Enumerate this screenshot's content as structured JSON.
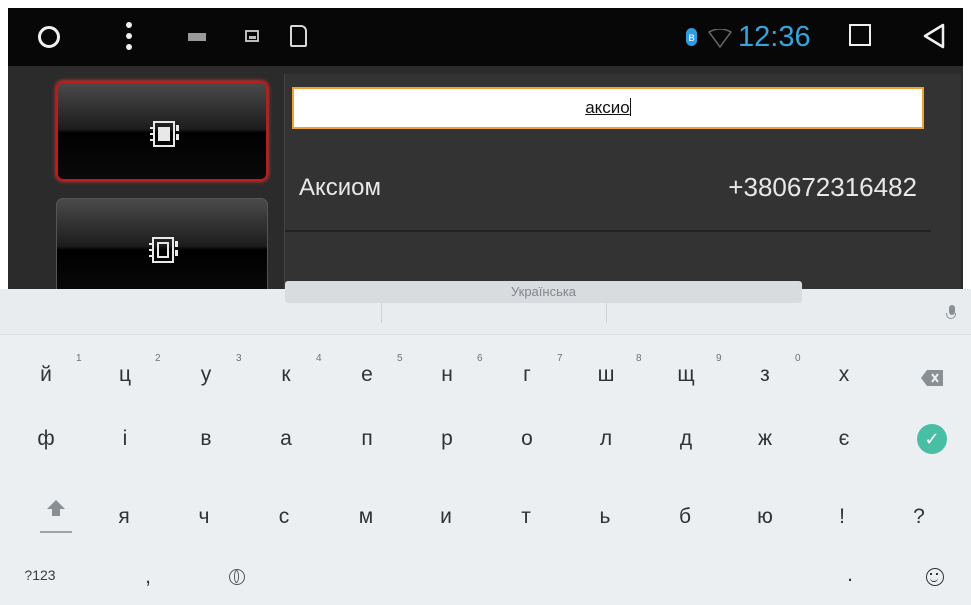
{
  "status_bar": {
    "time": "12:36",
    "icons": [
      "home-circle-icon",
      "menu-dots-icon",
      "keyboard-icon",
      "image-icon",
      "sd-card-icon",
      "bluetooth-icon",
      "wifi-icon",
      "recents-square-icon",
      "back-triangle-icon"
    ],
    "accent_color": "#35a4dd"
  },
  "left_buttons": [
    {
      "name": "contacts-book-icon",
      "state": "selected"
    },
    {
      "name": "contacts-sd-icon",
      "state": "normal"
    }
  ],
  "search": {
    "value": "аксио"
  },
  "contacts": [
    {
      "name": "Аксиом",
      "phone": "+380672316482"
    }
  ],
  "keyboard": {
    "row1": [
      "й",
      "ц",
      "у",
      "к",
      "е",
      "н",
      "г",
      "ш",
      "щ",
      "з",
      "х"
    ],
    "row1_hints": [
      "1",
      "2",
      "3",
      "4",
      "5",
      "6",
      "7",
      "8",
      "9",
      "0"
    ],
    "row2": [
      "ф",
      "і",
      "в",
      "а",
      "п",
      "р",
      "о",
      "л",
      "д",
      "ж",
      "є"
    ],
    "row3": [
      "я",
      "ч",
      "с",
      "м",
      "и",
      "т",
      "ь",
      "б",
      "ю",
      "!",
      "?"
    ],
    "bottom": {
      "symbols": "?123",
      "comma": ",",
      "space": "Українська",
      "period": "."
    },
    "accent_color": "#48bfa5"
  }
}
